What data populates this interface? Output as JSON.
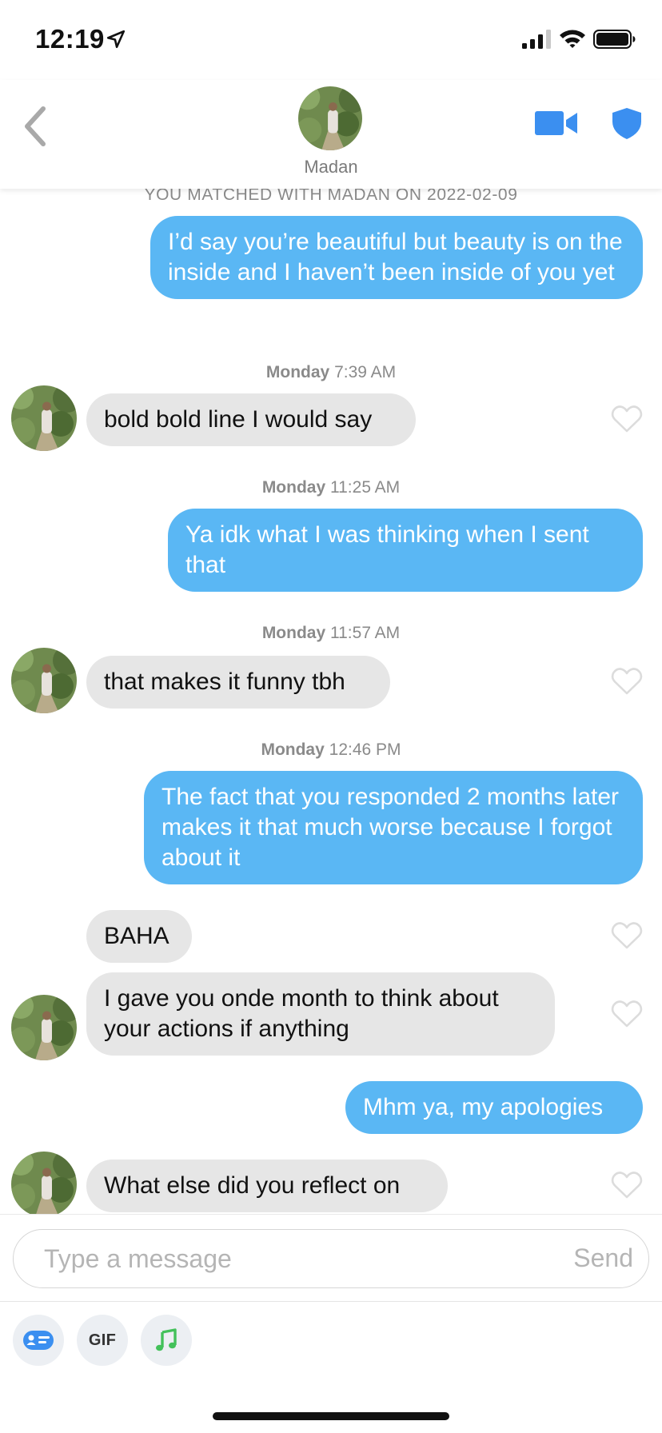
{
  "status_bar": {
    "time": "12:19"
  },
  "header": {
    "name": "Madan"
  },
  "chat": {
    "match_notice": "YOU MATCHED WITH MADAN ON 2022-02-09",
    "messages": [
      {
        "kind": "out",
        "text": "I’d say you’re beautiful but beauty is on the inside and I haven’t been inside of you yet"
      },
      {
        "kind": "stamp",
        "day": "Monday",
        "time": "7:39 AM"
      },
      {
        "kind": "in",
        "text": "bold bold line I would say"
      },
      {
        "kind": "stamp",
        "day": "Monday",
        "time": "11:25 AM"
      },
      {
        "kind": "out",
        "text": "Ya idk what I was thinking when I sent that"
      },
      {
        "kind": "stamp",
        "day": "Monday",
        "time": "11:57 AM"
      },
      {
        "kind": "in",
        "text": "that makes it funny tbh"
      },
      {
        "kind": "stamp",
        "day": "Monday",
        "time": "12:46 PM"
      },
      {
        "kind": "out",
        "text": "The fact that you responded 2 months later makes it that much worse because I forgot about it"
      },
      {
        "kind": "in",
        "text": "BAHA"
      },
      {
        "kind": "in",
        "text": "I gave you onde month to think about your actions if anything"
      },
      {
        "kind": "out",
        "text": "Mhm ya, my apologies"
      },
      {
        "kind": "in",
        "text": "What else did you reflect on"
      }
    ]
  },
  "composer": {
    "placeholder": "Type a message",
    "send_label": "Send"
  },
  "toolbar": {
    "gif_label": "GIF"
  },
  "colors": {
    "outgoing": "#5ab7f4",
    "incoming": "#e6e6e6",
    "accent": "#3b8ff0"
  }
}
